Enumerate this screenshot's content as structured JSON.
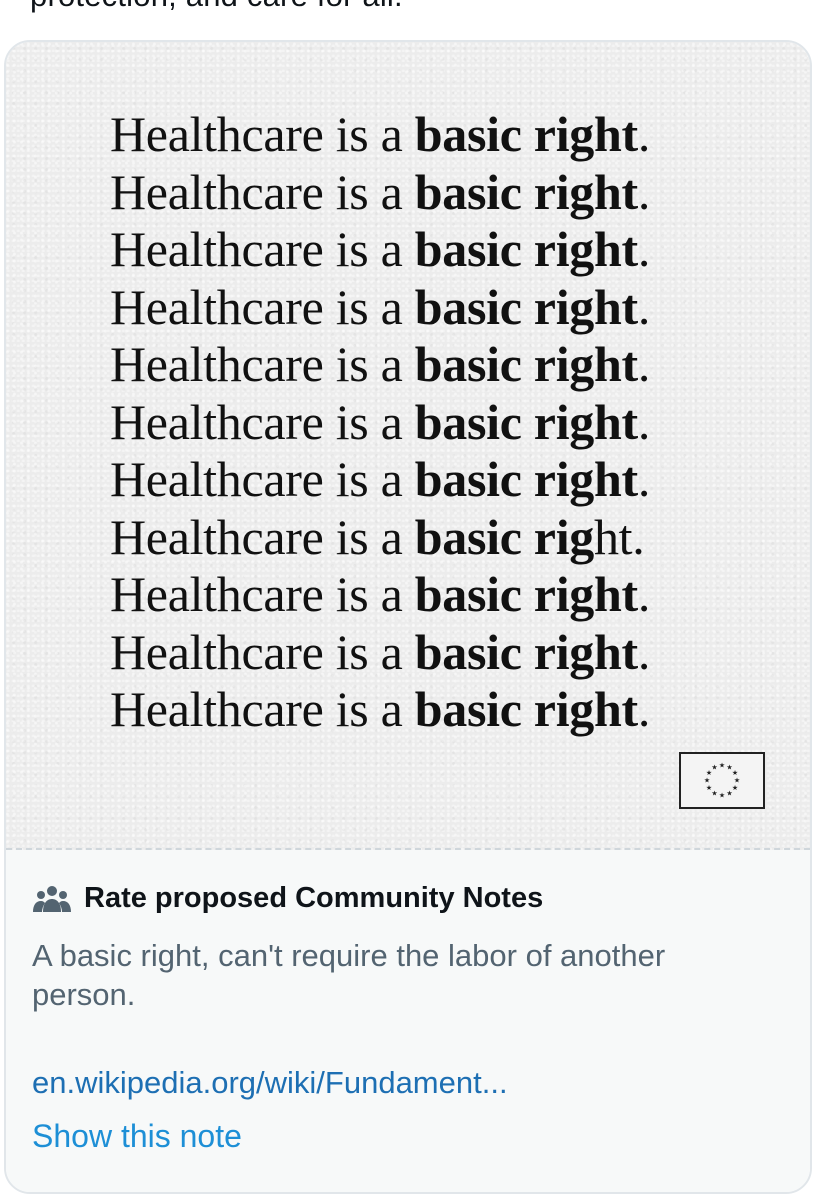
{
  "tweet": {
    "text_fragment": "protection, and care for all."
  },
  "poster": {
    "lines": [
      {
        "regular": "Healthcare is a ",
        "bold": "basic right",
        "end": "."
      },
      {
        "regular": "Healthcare is a ",
        "bold": "basic right",
        "end": "."
      },
      {
        "regular": "Healthcare is a ",
        "bold": "basic right",
        "end": "."
      },
      {
        "regular": "Healthcare is a ",
        "bold": "basic right",
        "end": "."
      },
      {
        "regular": "Healthcare is a ",
        "bold": "basic right",
        "end": "."
      },
      {
        "regular": "Healthcare is a ",
        "bold": "basic right",
        "end": "."
      },
      {
        "regular": "Healthcare is a ",
        "bold": "basic right",
        "end": "."
      },
      {
        "regular": "Healthcare is a ",
        "bold": "basic ",
        "bold_extra": "rig",
        "tail": "ht."
      },
      {
        "regular": "Healthcare is a ",
        "bold": "basic right",
        "end": "."
      },
      {
        "regular": "Healthcare is a ",
        "bold": "basic right",
        "end": "."
      },
      {
        "regular": "Healthcare is a ",
        "bold": "basic right",
        "end": "."
      }
    ],
    "flag_icon": "eu-flag-icon"
  },
  "community_note": {
    "icon": "people-icon",
    "title": "Rate proposed Community Notes",
    "body": "A basic right, can't require the labor of another person.",
    "link": "en.wikipedia.org/wiki/Fundament...",
    "action": "Show this note"
  },
  "colors": {
    "text_primary": "#0f1419",
    "text_secondary": "#536471",
    "link": "#1d6fb3",
    "note_bg": "#f7f9f9"
  }
}
